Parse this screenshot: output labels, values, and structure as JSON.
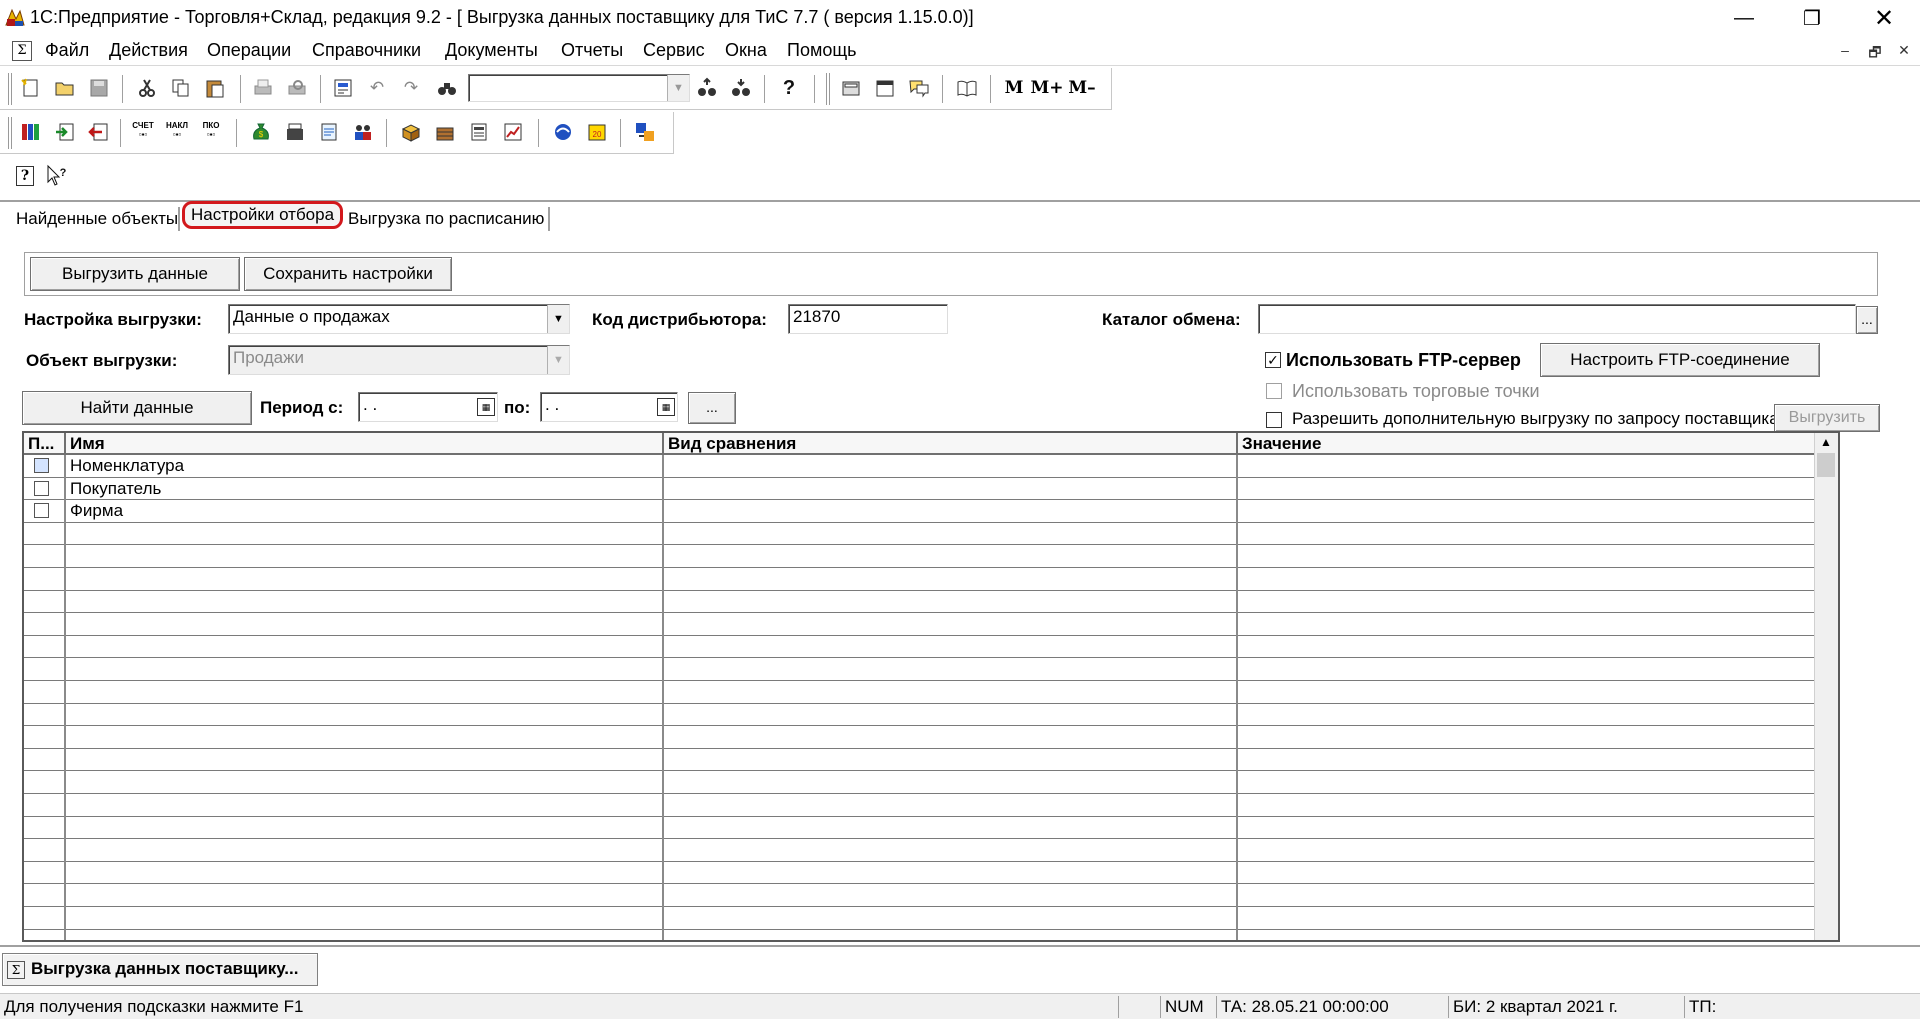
{
  "window": {
    "title": "1С:Предприятие - Торговля+Склад, редакция 9.2 - [ Выгрузка данных поставщику для ТиС 7.7 ( версия 1.15.0.0)]",
    "minimize": "—",
    "restore": "❐",
    "close": "✕"
  },
  "menu": {
    "sys_icon": "Σ",
    "items": [
      "Файл",
      "Действия",
      "Операции",
      "Справочники",
      "Документы",
      "Отчеты",
      "Сервис",
      "Окна",
      "Помощь"
    ],
    "mdi_min": "–",
    "mdi_restore": "🗗",
    "mdi_close": "✕"
  },
  "toolbar": {
    "memory_buttons": [
      "M",
      "M+",
      "M–"
    ],
    "doc_labels": [
      "СЧЕТ",
      "НАКЛ",
      "ПКО"
    ],
    "help_glyph": "?"
  },
  "tabs": [
    "Найденные объекты",
    "Настройки отбора",
    "Выгрузка по расписанию"
  ],
  "form": {
    "upload_button": "Выгрузить данные",
    "save_button": "Сохранить настройки",
    "setting_label": "Настройка выгрузки:",
    "setting_value": "Данные о продажах",
    "distributor_label": "Код дистрибьютора:",
    "distributor_value": "21870",
    "catalog_label": "Каталог обмена:",
    "catalog_value": "",
    "catalog_btn": "...",
    "object_label": "Объект выгрузки:",
    "object_value": "Продажи",
    "ftp_checkbox_label": "Использовать FTP-сервер",
    "ftp_checked": "✓",
    "ftp_button": "Настроить FTP-соединение",
    "trade_points_label": "Использовать торговые точки",
    "allow_extra_label": "Разрешить дополнительную выгрузку по запросу поставщика",
    "extra_upload_button": "Выгрузить",
    "find_button": "Найти данные",
    "period_from_label": "Период с:",
    "period_from_value": " .  .",
    "period_to_label": "по:",
    "period_to_value": " .  .",
    "period_btn": "..."
  },
  "grid": {
    "columns": [
      "П...",
      "Имя",
      "Вид сравнения",
      "Значение"
    ],
    "rows": [
      {
        "name": "Номенклатура",
        "comparison": "",
        "value": ""
      },
      {
        "name": "Покупатель",
        "comparison": "",
        "value": ""
      },
      {
        "name": "Фирма",
        "comparison": "",
        "value": ""
      }
    ]
  },
  "taskbar": {
    "window_tab": "Выгрузка данных поставщику..."
  },
  "status": {
    "hint": "Для получения подсказки нажмите F1",
    "num": "NUM",
    "ta": "ТА: 28.05.21  00:00:00",
    "bi": "БИ: 2 квартал 2021 г.",
    "tp": "ТП:"
  }
}
